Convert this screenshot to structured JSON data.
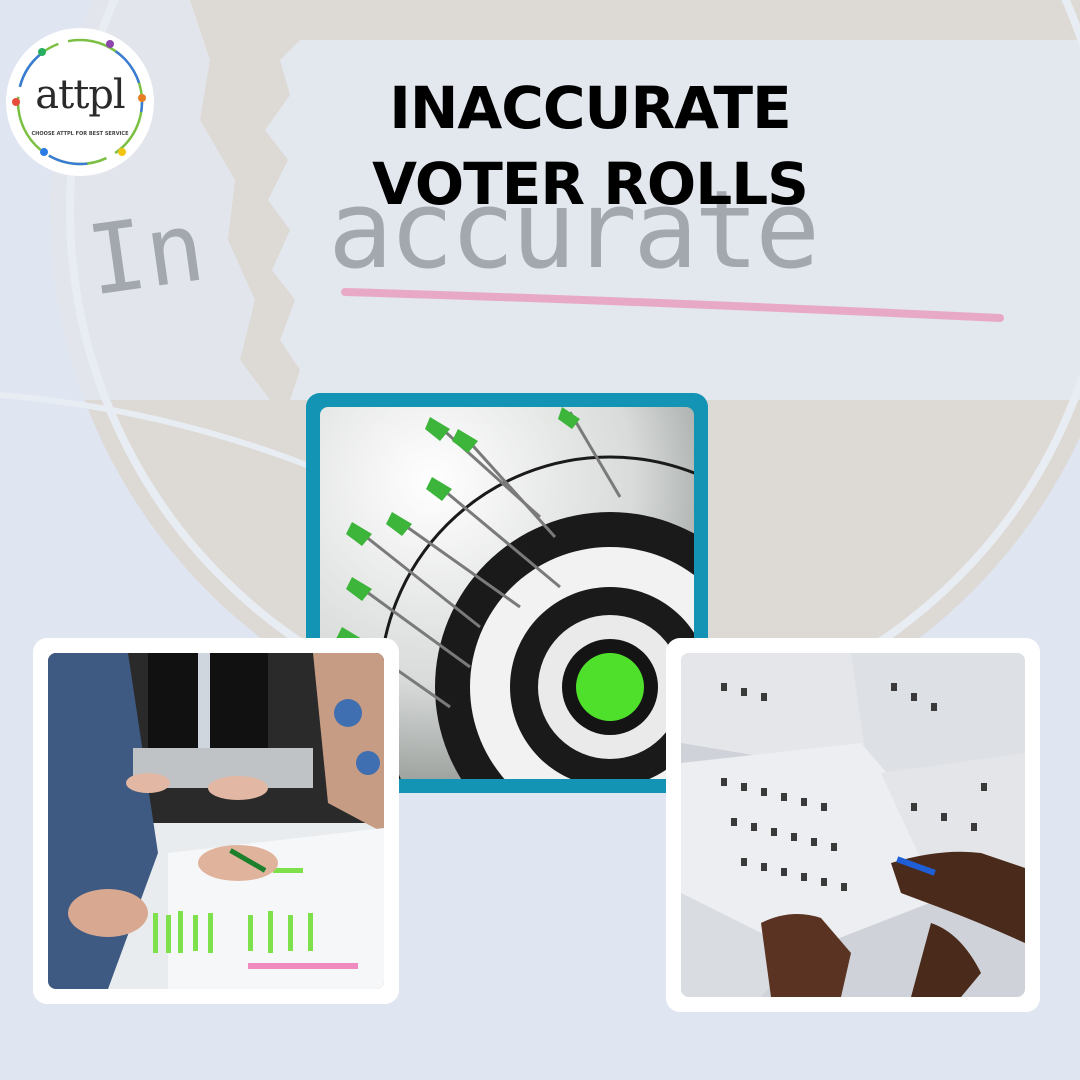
{
  "logo": {
    "brand": "attpl",
    "tagline": "CHOOSE ATTPL FOR BEST SERVICE"
  },
  "title": {
    "line1": "INACCURATE",
    "line2": "VOTER ROLLS"
  },
  "background_words": {
    "left": "In",
    "right": "accurate"
  },
  "colors": {
    "background": "#dfe5f1",
    "frame_teal": "#1394b4",
    "frame_white": "#ffffff",
    "underline_pink": "#e8a9c7",
    "target_green": "#4ee02a"
  },
  "images": {
    "left": "people-marking-documents",
    "center": "arrows-target",
    "right": "hands-on-voter-lists"
  }
}
